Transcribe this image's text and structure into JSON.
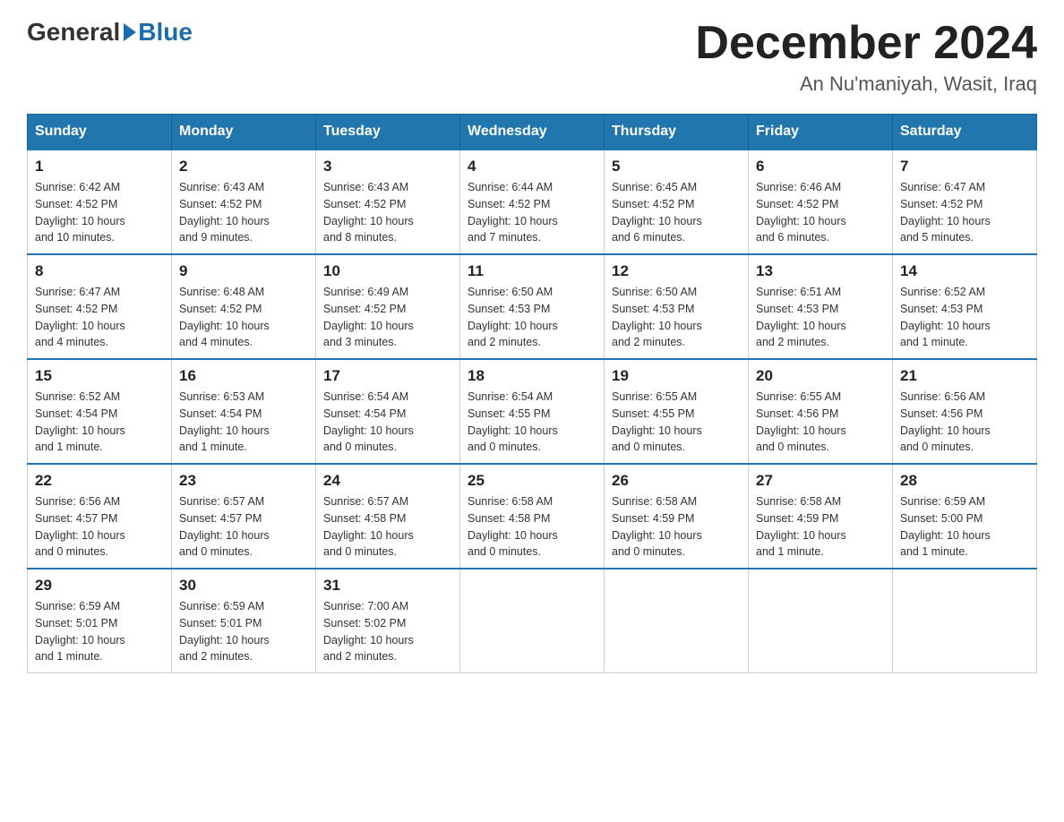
{
  "header": {
    "logo_general": "General",
    "logo_blue": "Blue",
    "month_title": "December 2024",
    "location": "An Nu'maniyah, Wasit, Iraq"
  },
  "days_of_week": [
    "Sunday",
    "Monday",
    "Tuesday",
    "Wednesday",
    "Thursday",
    "Friday",
    "Saturday"
  ],
  "weeks": [
    [
      {
        "day": "1",
        "sunrise": "6:42 AM",
        "sunset": "4:52 PM",
        "daylight": "10 hours and 10 minutes."
      },
      {
        "day": "2",
        "sunrise": "6:43 AM",
        "sunset": "4:52 PM",
        "daylight": "10 hours and 9 minutes."
      },
      {
        "day": "3",
        "sunrise": "6:43 AM",
        "sunset": "4:52 PM",
        "daylight": "10 hours and 8 minutes."
      },
      {
        "day": "4",
        "sunrise": "6:44 AM",
        "sunset": "4:52 PM",
        "daylight": "10 hours and 7 minutes."
      },
      {
        "day": "5",
        "sunrise": "6:45 AM",
        "sunset": "4:52 PM",
        "daylight": "10 hours and 6 minutes."
      },
      {
        "day": "6",
        "sunrise": "6:46 AM",
        "sunset": "4:52 PM",
        "daylight": "10 hours and 6 minutes."
      },
      {
        "day": "7",
        "sunrise": "6:47 AM",
        "sunset": "4:52 PM",
        "daylight": "10 hours and 5 minutes."
      }
    ],
    [
      {
        "day": "8",
        "sunrise": "6:47 AM",
        "sunset": "4:52 PM",
        "daylight": "10 hours and 4 minutes."
      },
      {
        "day": "9",
        "sunrise": "6:48 AM",
        "sunset": "4:52 PM",
        "daylight": "10 hours and 4 minutes."
      },
      {
        "day": "10",
        "sunrise": "6:49 AM",
        "sunset": "4:52 PM",
        "daylight": "10 hours and 3 minutes."
      },
      {
        "day": "11",
        "sunrise": "6:50 AM",
        "sunset": "4:53 PM",
        "daylight": "10 hours and 2 minutes."
      },
      {
        "day": "12",
        "sunrise": "6:50 AM",
        "sunset": "4:53 PM",
        "daylight": "10 hours and 2 minutes."
      },
      {
        "day": "13",
        "sunrise": "6:51 AM",
        "sunset": "4:53 PM",
        "daylight": "10 hours and 2 minutes."
      },
      {
        "day": "14",
        "sunrise": "6:52 AM",
        "sunset": "4:53 PM",
        "daylight": "10 hours and 1 minute."
      }
    ],
    [
      {
        "day": "15",
        "sunrise": "6:52 AM",
        "sunset": "4:54 PM",
        "daylight": "10 hours and 1 minute."
      },
      {
        "day": "16",
        "sunrise": "6:53 AM",
        "sunset": "4:54 PM",
        "daylight": "10 hours and 1 minute."
      },
      {
        "day": "17",
        "sunrise": "6:54 AM",
        "sunset": "4:54 PM",
        "daylight": "10 hours and 0 minutes."
      },
      {
        "day": "18",
        "sunrise": "6:54 AM",
        "sunset": "4:55 PM",
        "daylight": "10 hours and 0 minutes."
      },
      {
        "day": "19",
        "sunrise": "6:55 AM",
        "sunset": "4:55 PM",
        "daylight": "10 hours and 0 minutes."
      },
      {
        "day": "20",
        "sunrise": "6:55 AM",
        "sunset": "4:56 PM",
        "daylight": "10 hours and 0 minutes."
      },
      {
        "day": "21",
        "sunrise": "6:56 AM",
        "sunset": "4:56 PM",
        "daylight": "10 hours and 0 minutes."
      }
    ],
    [
      {
        "day": "22",
        "sunrise": "6:56 AM",
        "sunset": "4:57 PM",
        "daylight": "10 hours and 0 minutes."
      },
      {
        "day": "23",
        "sunrise": "6:57 AM",
        "sunset": "4:57 PM",
        "daylight": "10 hours and 0 minutes."
      },
      {
        "day": "24",
        "sunrise": "6:57 AM",
        "sunset": "4:58 PM",
        "daylight": "10 hours and 0 minutes."
      },
      {
        "day": "25",
        "sunrise": "6:58 AM",
        "sunset": "4:58 PM",
        "daylight": "10 hours and 0 minutes."
      },
      {
        "day": "26",
        "sunrise": "6:58 AM",
        "sunset": "4:59 PM",
        "daylight": "10 hours and 0 minutes."
      },
      {
        "day": "27",
        "sunrise": "6:58 AM",
        "sunset": "4:59 PM",
        "daylight": "10 hours and 1 minute."
      },
      {
        "day": "28",
        "sunrise": "6:59 AM",
        "sunset": "5:00 PM",
        "daylight": "10 hours and 1 minute."
      }
    ],
    [
      {
        "day": "29",
        "sunrise": "6:59 AM",
        "sunset": "5:01 PM",
        "daylight": "10 hours and 1 minute."
      },
      {
        "day": "30",
        "sunrise": "6:59 AM",
        "sunset": "5:01 PM",
        "daylight": "10 hours and 2 minutes."
      },
      {
        "day": "31",
        "sunrise": "7:00 AM",
        "sunset": "5:02 PM",
        "daylight": "10 hours and 2 minutes."
      },
      null,
      null,
      null,
      null
    ]
  ],
  "labels": {
    "sunrise": "Sunrise:",
    "sunset": "Sunset:",
    "daylight": "Daylight:"
  }
}
